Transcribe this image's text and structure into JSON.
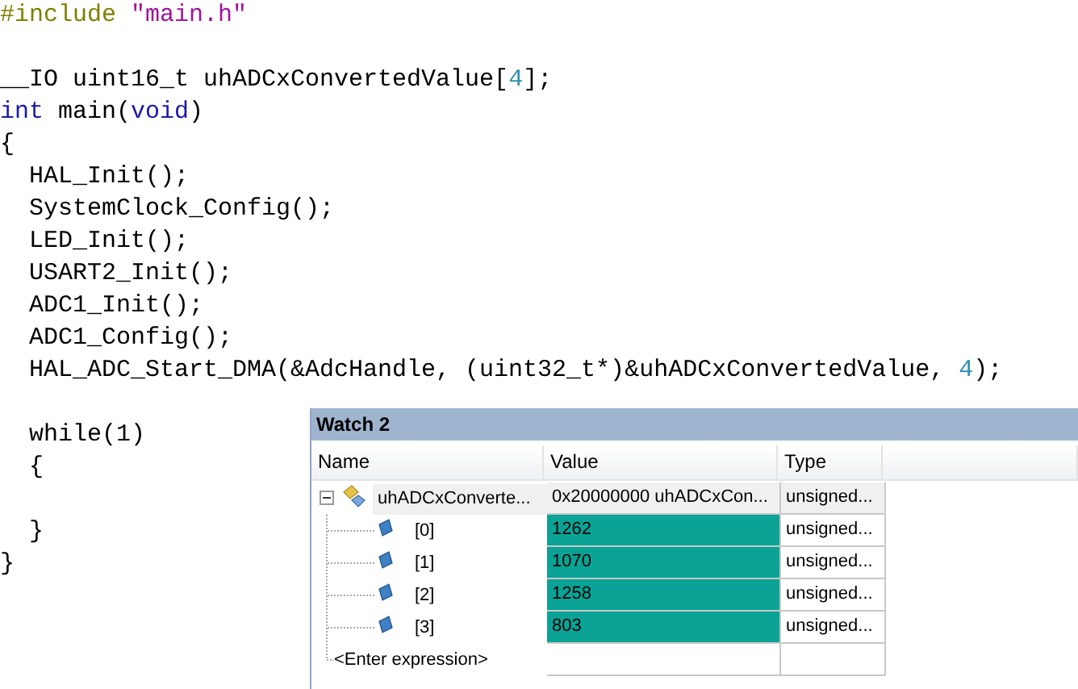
{
  "editor": {
    "lines": [
      [
        {
          "kind": "directive",
          "text": "#include "
        },
        {
          "kind": "string",
          "text": "\"main.h\""
        }
      ],
      {
        "kind": "blank"
      },
      [
        {
          "kind": "plain",
          "text": "__IO uint16_t uhADCxConvertedValue["
        },
        {
          "kind": "number",
          "text": "4"
        },
        {
          "kind": "plain",
          "text": "];"
        }
      ],
      [
        {
          "kind": "keyword",
          "text": "int"
        },
        {
          "kind": "plain",
          "text": " main("
        },
        {
          "kind": "keyword",
          "text": "void"
        },
        {
          "kind": "plain",
          "text": ")"
        }
      ],
      [
        {
          "kind": "plain",
          "text": "{"
        }
      ],
      [
        {
          "kind": "plain",
          "text": "  HAL_Init();"
        }
      ],
      [
        {
          "kind": "plain",
          "text": "  SystemClock_Config();"
        }
      ],
      [
        {
          "kind": "plain",
          "text": "  LED_Init();"
        }
      ],
      [
        {
          "kind": "plain",
          "text": "  USART2_Init();"
        }
      ],
      [
        {
          "kind": "plain",
          "text": "  ADC1_Init();"
        }
      ],
      [
        {
          "kind": "plain",
          "text": "  ADC1_Config();"
        }
      ],
      [
        {
          "kind": "plain",
          "text": "  HAL_ADC_Start_DMA(&AdcHandle, (uint32_t*)&uhADCxConvertedValue, "
        },
        {
          "kind": "number",
          "text": "4"
        },
        {
          "kind": "plain",
          "text": ");"
        }
      ],
      {
        "kind": "blank"
      },
      [
        {
          "kind": "plain",
          "text": "  while(1)"
        }
      ],
      [
        {
          "kind": "plain",
          "text": "  {"
        }
      ],
      {
        "kind": "blank"
      },
      [
        {
          "kind": "plain",
          "text": "  }"
        }
      ],
      [
        {
          "kind": "plain",
          "text": "}"
        }
      ]
    ]
  },
  "watch": {
    "title": "Watch 2",
    "columns": [
      "Name",
      "Value",
      "Type"
    ],
    "rows": [
      {
        "name": "uhADCxConverte...",
        "value": "0x20000000 uhADCxCon...",
        "type": "unsigned...",
        "expanded": true,
        "children": [
          {
            "name": "[0]",
            "value": "1262",
            "type": "unsigned...",
            "changed": true
          },
          {
            "name": "[1]",
            "value": "1070",
            "type": "unsigned...",
            "changed": true
          },
          {
            "name": "[2]",
            "value": "1258",
            "type": "unsigned...",
            "changed": true
          },
          {
            "name": "[3]",
            "value": "803",
            "type": "unsigned...",
            "changed": true
          }
        ]
      }
    ],
    "new_row": {
      "placeholder": "<Enter expression>"
    }
  }
}
